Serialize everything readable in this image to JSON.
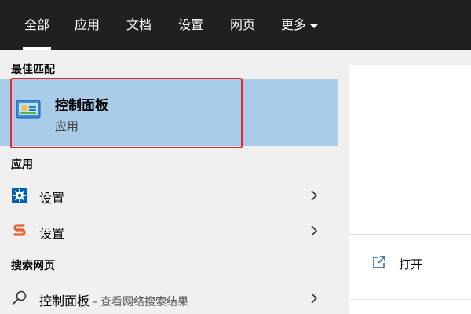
{
  "tabs": [
    {
      "label": "全部",
      "active": true
    },
    {
      "label": "应用"
    },
    {
      "label": "文档"
    },
    {
      "label": "设置"
    },
    {
      "label": "网页"
    },
    {
      "label": "更多"
    }
  ],
  "sections": {
    "best_match": "最佳匹配",
    "apps": "应用",
    "web": "搜索网页"
  },
  "best_match": {
    "title": "控制面板",
    "subtitle": "应用"
  },
  "apps": [
    {
      "label": "设置",
      "icon": "gear-icon"
    },
    {
      "label": "设置",
      "icon": "s-app-icon"
    }
  ],
  "web_result": {
    "label": "控制面板",
    "suffix": " - 查看网络搜索结果"
  },
  "preview": {
    "open_label": "打开"
  },
  "colors": {
    "topbar": "#202020",
    "selected": "#a9cce9",
    "highlight_border": "#e8262b",
    "gear_blue": "#0063b1",
    "s_orange": "#f05a28"
  }
}
